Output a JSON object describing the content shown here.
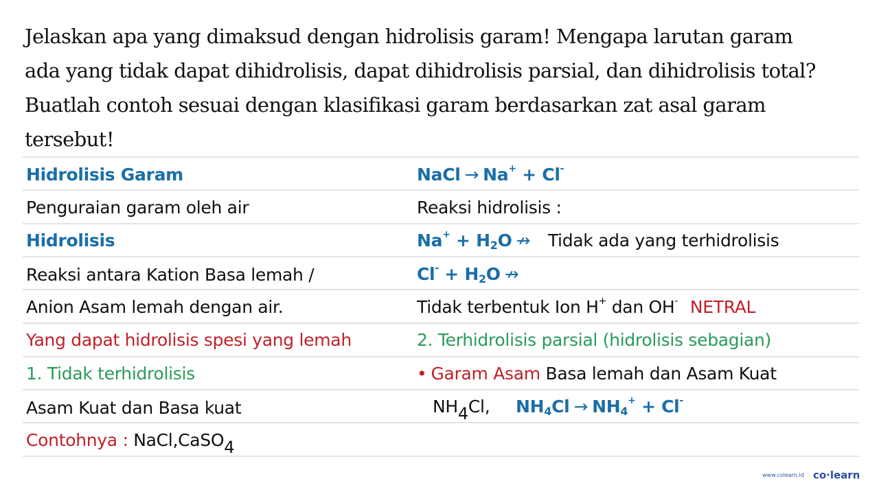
{
  "question": {
    "lines": [
      "Jelaskan apa yang dimaksud dengan hidrolisis garam! Mengapa larutan garam",
      "ada yang tidak dapat dihidrolisis, dapat dihidrolisis parsial, dan dihidrolisis total?",
      "Buatlah contoh sesuai dengan klasifikasi garam berdasarkan zat asal garam",
      "tersebut!"
    ]
  },
  "left": {
    "title": "Hidrolisis Garam",
    "definition": "Penguraian garam oleh air",
    "subtitle": "Hidrolisis",
    "reaction_line1": "Reaksi antara Kation Basa lemah /",
    "reaction_line2": "Anion Asam lemah dengan air.",
    "note": "Yang dapat hidrolisis spesi yang lemah",
    "type1": "1. Tidak terhidrolisis",
    "type1_desc": "Asam Kuat dan Basa kuat",
    "example_label": "Contohnya :",
    "example_1": "NaCl,",
    "example_2_base": "CaSO",
    "example_2_sub": "4"
  },
  "right": {
    "eq1": {
      "lhs": "NaCl",
      "arrow": "→",
      "p1": "Na",
      "p1_charge": "+",
      "plus": "+",
      "p2": "Cl",
      "p2_charge": "-"
    },
    "reaksi_label": "Reaksi hidrolisis :",
    "eq2": {
      "ion": "Na",
      "charge": "+",
      "plus": "+",
      "h": "H",
      "sub": "2",
      "o": "O",
      "arrow": "↛",
      "comment": "Tidak ada yang terhidrolisis"
    },
    "eq3": {
      "ion": "Cl",
      "charge": "-",
      "plus": "+",
      "h": "H",
      "sub": "2",
      "o": "O",
      "arrow": "↛"
    },
    "result": {
      "text_a": "Tidak terbentuk Ion H",
      "h_charge": "+",
      "text_b": " dan OH",
      "oh_charge": "-",
      "verdict": "NETRAL"
    },
    "type2": "2. Terhidrolisis parsial (hidrolisis sebagian)",
    "garam_asam": {
      "bullet": "•",
      "label": "Garam Asam",
      "desc": "Basa lemah dan Asam Kuat"
    },
    "example": {
      "nh": "NH",
      "sub": "4",
      "cl": "Cl,"
    },
    "eq4": {
      "lhs_nh": "NH",
      "lhs_sub": "4",
      "lhs_cl": "Cl",
      "arrow": "→",
      "p1": "NH",
      "p1_sub": "4",
      "p1_charge": "+",
      "plus": "+",
      "p2": "Cl",
      "p2_charge": "-"
    }
  },
  "branding": {
    "url": "www.colearn.id",
    "brand": "co·learn"
  },
  "colors": {
    "blue": "#1a6ea8",
    "red": "#c0202a",
    "green": "#2a9a5a",
    "brand": "#2b4fa0"
  }
}
